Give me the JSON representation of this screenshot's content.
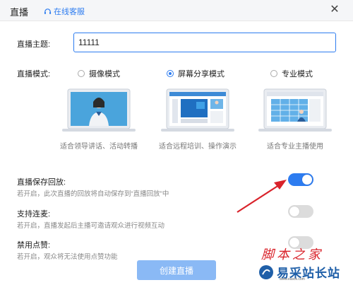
{
  "window": {
    "title": "直播",
    "service_link": "在线客服"
  },
  "topic": {
    "label": "直播主题:",
    "value": "11111"
  },
  "mode": {
    "label": "直播模式:",
    "options": [
      {
        "label": "摄像模式",
        "caption": "适合领导讲话、活动转播",
        "checked": false
      },
      {
        "label": "屏幕分享模式",
        "caption": "适合远程培训、操作演示",
        "checked": true
      },
      {
        "label": "专业模式",
        "caption": "适合专业主播使用",
        "checked": false
      }
    ]
  },
  "settings": [
    {
      "title": "直播保存回放:",
      "desc": "若开启，此次直播的回放将自动保存到“直播回放”中",
      "on": true
    },
    {
      "title": "支持连麦:",
      "desc": "若开启，直播发起后主播可邀请观众进行视频互动",
      "on": false
    },
    {
      "title": "禁用点赞:",
      "desc": "若开启，观众将无法使用点赞功能",
      "on": false
    }
  ],
  "create_button": "创建直播",
  "watermark": {
    "line1": "脚本之家",
    "line2": "易采站长站",
    "line3": "www.easck.com"
  },
  "colors": {
    "accent": "#2d7cf0",
    "arrow": "#d9232b"
  }
}
